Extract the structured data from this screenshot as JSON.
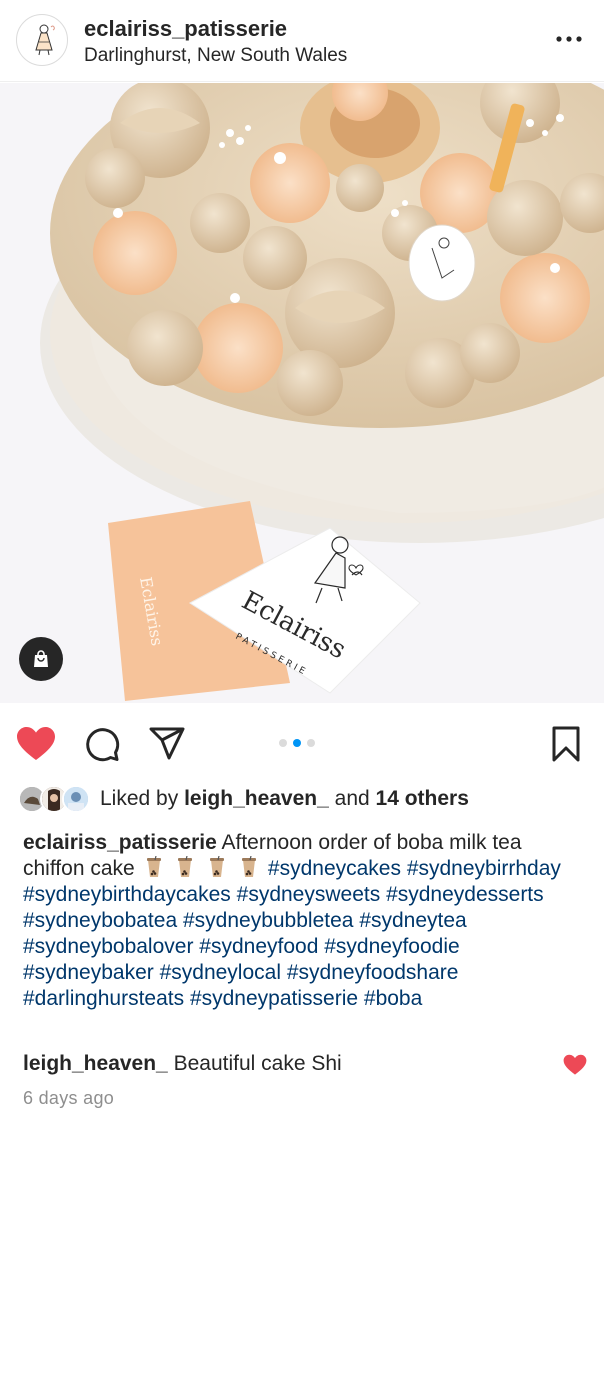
{
  "post": {
    "username": "eclairiss_patisserie",
    "location": "Darlinghurst, New South Wales",
    "carousel_index": 2,
    "carousel_count": 3
  },
  "photo": {
    "card_text": "Eclairiss",
    "card_subtext": "PATISSERIE"
  },
  "likes": {
    "prefix": "Liked by",
    "user": "leigh_heaven_",
    "conjunction": "and",
    "others": "14 others"
  },
  "caption": {
    "username": "eclairiss_patisserie",
    "text": "Afternoon order of boba milk tea chiffon cake",
    "emoji_count": 4,
    "hashtags": [
      "#sydneycakes",
      "#sydneybirrhday",
      "#sydneybirthdaycakes",
      "#sydneysweets",
      "#sydneydesserts",
      "#sydneybobatea",
      "#sydneybubbletea",
      "#sydneytea",
      "#sydneybobalover",
      "#sydneyfood",
      "#sydneyfoodie",
      "#sydneybaker",
      "#sydneylocal",
      "#sydneyfoodshare",
      "#darlinghursteats",
      "#sydneypatisserie",
      "#boba"
    ]
  },
  "comment": {
    "username": "leigh_heaven_",
    "text": "Beautiful cake Shi",
    "liked": true
  },
  "timestamp": "6 days ago",
  "icons": {
    "like": "heart-filled-icon",
    "comment": "comment-bubble-icon",
    "share": "paper-plane-icon",
    "save": "bookmark-icon",
    "more": "more-dots-icon",
    "shop": "shopping-bag-icon"
  },
  "colors": {
    "like_red": "#ed4956",
    "hashtag": "#00376b",
    "carousel_active": "#0095f6",
    "muted": "#8e8e8e"
  }
}
